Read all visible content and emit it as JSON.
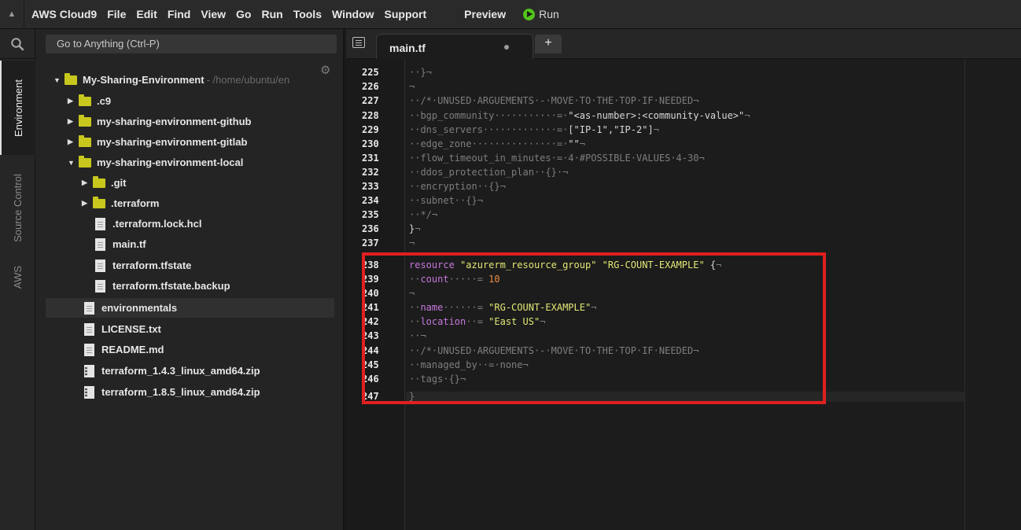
{
  "menubar": {
    "toggle_glyph": "▲",
    "brand": "AWS Cloud9",
    "items": [
      "File",
      "Edit",
      "Find",
      "View",
      "Go",
      "Run",
      "Tools",
      "Window",
      "Support"
    ],
    "preview": "Preview",
    "run": "Run"
  },
  "sidebar_tabs": {
    "environment": "Environment",
    "source_control": "Source Control",
    "aws": "AWS"
  },
  "filetree": {
    "goto_placeholder": "Go to Anything (Ctrl-P)",
    "root": {
      "name": "My-Sharing-Environment",
      "path": "- /home/ubuntu/en"
    },
    "rows": [
      {
        "name": ".c9"
      },
      {
        "name": "my-sharing-environment-github"
      },
      {
        "name": "my-sharing-environment-gitlab"
      },
      {
        "name": "my-sharing-environment-local"
      },
      {
        "name": ".git"
      },
      {
        "name": ".terraform"
      },
      {
        "name": ".terraform.lock.hcl"
      },
      {
        "name": "main.tf"
      },
      {
        "name": "terraform.tfstate"
      },
      {
        "name": "terraform.tfstate.backup"
      },
      {
        "name": "environmentals"
      },
      {
        "name": "LICENSE.txt"
      },
      {
        "name": "README.md"
      },
      {
        "name": "terraform_1.4.3_linux_amd64.zip"
      },
      {
        "name": "terraform_1.8.5_linux_amd64.zip"
      }
    ]
  },
  "editor": {
    "tab_label": "main.tf",
    "add_tab": "+",
    "line_numbers": [
      "225",
      "226",
      "227",
      "228",
      "229",
      "230",
      "231",
      "232",
      "233",
      "234",
      "235",
      "236",
      "237",
      "238",
      "239",
      "240",
      "241",
      "242",
      "243",
      "244",
      "245",
      "246",
      "247"
    ],
    "lines": {
      "l225": "··}¬",
      "l226": "¬",
      "l227": "··/*·UNUSED·ARGUEMENTS·-·MOVE·TO·THE·TOP·IF·NEEDED¬",
      "l228a": "··bgp_community···········=·",
      "l228b": "\"<as-number>:<community-value>\"",
      "l228c": "¬",
      "l229a": "··dns_servers·············=·",
      "l229b": "[\"IP-1\",\"IP-2\"]",
      "l229c": "¬",
      "l230a": "··edge_zone···············=·",
      "l230b": "\"\"",
      "l230c": "¬",
      "l231": "··flow_timeout_in_minutes·=·4·#POSSIBLE·VALUES·4-30¬",
      "l232": "··ddos_protection_plan··{}·¬",
      "l233": "··encryption··{}¬",
      "l234": "··subnet··{}¬",
      "l235": "··*/¬",
      "l236a": "}",
      "l236b": "¬",
      "l237": "¬",
      "l238a": "resource",
      "l238b": " \"azurerm_resource_group\" \"RG-COUNT-EXAMPLE\" ",
      "l238c": "{",
      "l238d": "¬",
      "l239a": "··",
      "l239b": "count",
      "l239c": "·····= ",
      "l239d": "10",
      "l240": "¬",
      "l241a": "··",
      "l241b": "name",
      "l241c": "······= ",
      "l241d": "\"RG-COUNT-EXAMPLE\"",
      "l241e": "¬",
      "l242a": "··",
      "l242b": "location",
      "l242c": "··= ",
      "l242d": "\"East US\"",
      "l242e": "¬",
      "l243": "··¬",
      "l244": "··/*·UNUSED·ARGUEMENTS·-·MOVE·TO·THE·TOP·IF·NEEDED¬",
      "l245": "··managed_by··=·none¬",
      "l246": "··tags·{}¬",
      "l247": "}"
    }
  },
  "colors": {
    "highlight_box": "#e02020",
    "keyword": "#c678dd",
    "string": "#e2e874",
    "number": "#f08d49",
    "folder": "#c8c71e",
    "run_icon": "#52c41a"
  }
}
